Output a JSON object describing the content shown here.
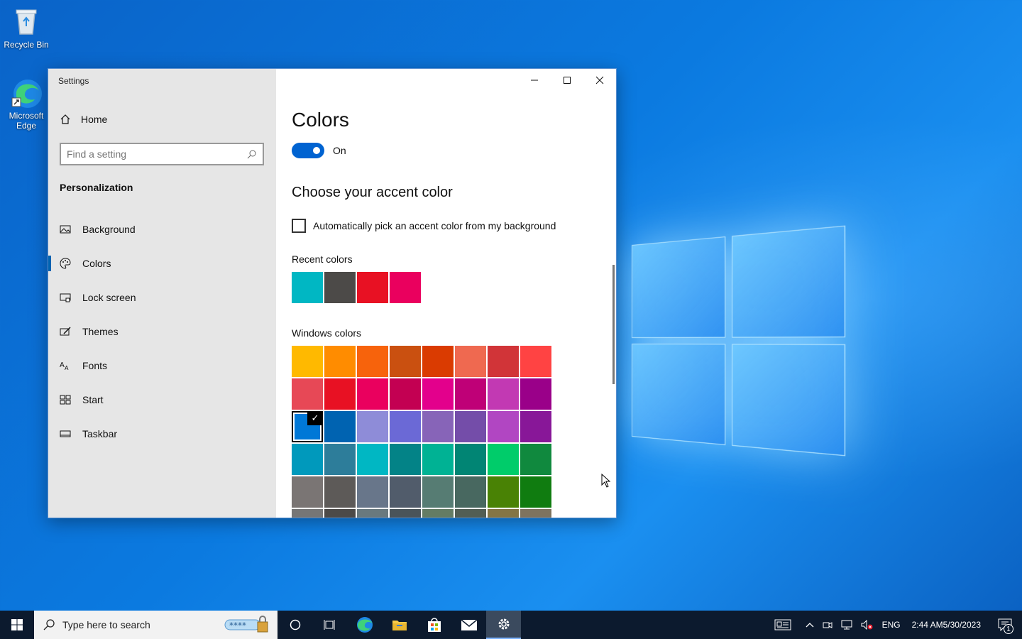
{
  "desktop": {
    "icons": [
      {
        "label": "Recycle Bin"
      },
      {
        "label": "Microsoft Edge"
      }
    ]
  },
  "window": {
    "title": "Settings",
    "home_label": "Home",
    "search_placeholder": "Find a setting",
    "section": "Personalization",
    "nav": [
      {
        "label": "Background",
        "icon": "image-icon"
      },
      {
        "label": "Colors",
        "icon": "palette-icon",
        "active": true
      },
      {
        "label": "Lock screen",
        "icon": "lock-screen-icon"
      },
      {
        "label": "Themes",
        "icon": "themes-icon"
      },
      {
        "label": "Fonts",
        "icon": "fonts-icon"
      },
      {
        "label": "Start",
        "icon": "start-icon"
      },
      {
        "label": "Taskbar",
        "icon": "taskbar-icon"
      }
    ]
  },
  "content": {
    "title": "Colors",
    "toggle_label": "On",
    "accent_title": "Choose your accent color",
    "auto_pick_label": "Automatically pick an accent color from my background",
    "recent_label": "Recent colors",
    "recent_colors": [
      "#00b7c3",
      "#4c4a48",
      "#e81123",
      "#ea005e"
    ],
    "windows_label": "Windows colors",
    "windows_colors": [
      "#ffb900",
      "#ff8c00",
      "#f7630c",
      "#ca5010",
      "#da3b01",
      "#ef6950",
      "#d13438",
      "#ff4343",
      "#e74856",
      "#e81123",
      "#ea005e",
      "#c30052",
      "#e3008c",
      "#bf0077",
      "#c239b3",
      "#9a0089",
      "#0078d7",
      "#0063b1",
      "#8e8cd8",
      "#6b69d6",
      "#8764b8",
      "#744da9",
      "#b146c2",
      "#881798",
      "#0099bc",
      "#2d7d9a",
      "#00b7c3",
      "#038387",
      "#00b294",
      "#018574",
      "#00cc6a",
      "#10893e",
      "#7a7574",
      "#5d5a58",
      "#68768a",
      "#515c6b",
      "#567c73",
      "#486860",
      "#498205",
      "#107c10",
      "#767676",
      "#4c4a48",
      "#69797e",
      "#4a5459",
      "#647c64",
      "#525e54",
      "#847545",
      "#7e735f"
    ],
    "selected_color": "#0078d7"
  },
  "taskbar": {
    "search_placeholder": "Type here to search",
    "language": "ENG",
    "time": "2:44 AM",
    "date": "5/30/2023",
    "notifications": "1"
  }
}
